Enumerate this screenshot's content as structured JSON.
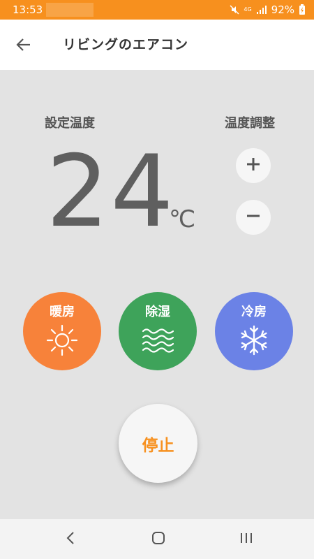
{
  "status_bar": {
    "time": "13:53",
    "network_label": "4G",
    "battery": "92%"
  },
  "app_bar": {
    "title": "リビングのエアコン",
    "back_icon": "arrow-left-icon"
  },
  "main": {
    "setting_label": "設定温度",
    "adjust_label": "温度調整",
    "temperature": "24",
    "unit": "℃",
    "plus_icon": "plus-icon",
    "minus_icon": "minus-icon"
  },
  "modes": [
    {
      "label": "暖房",
      "icon": "sun-icon",
      "color": "#f7823a"
    },
    {
      "label": "除湿",
      "icon": "waves-icon",
      "color": "#3ea35a"
    },
    {
      "label": "冷房",
      "icon": "snowflake-icon",
      "color": "#6b82e6"
    }
  ],
  "stop": {
    "label": "停止",
    "color": "#f7901e"
  },
  "nav": {
    "back_icon": "nav-back-icon",
    "home_icon": "nav-home-icon",
    "recent_icon": "nav-recent-icon"
  },
  "colors": {
    "status_bar": "#f7901e",
    "background": "#e3e3e3",
    "text": "#5f5f5f"
  }
}
